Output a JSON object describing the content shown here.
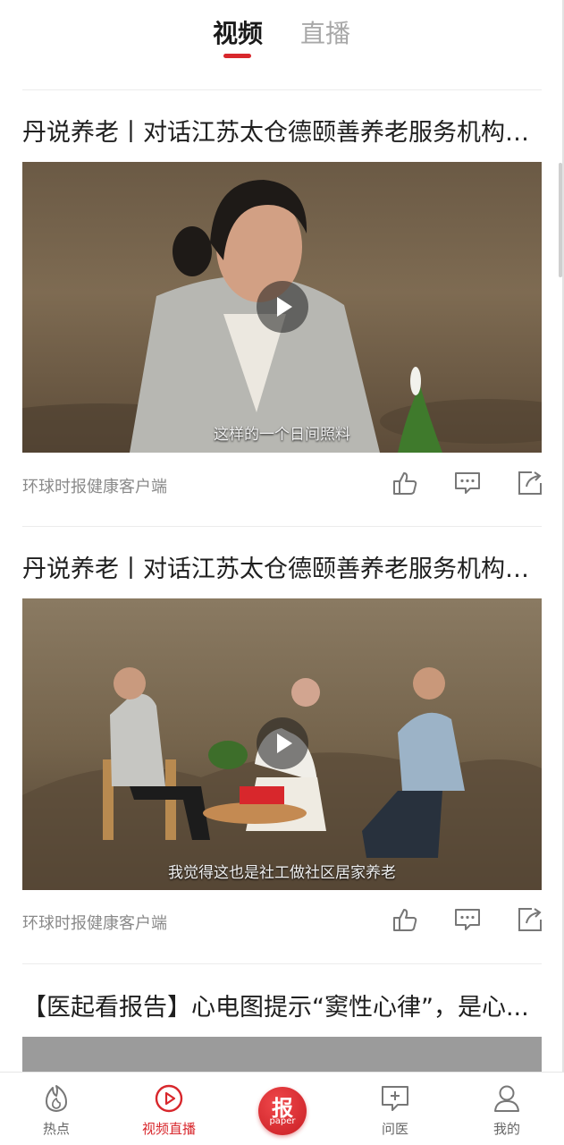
{
  "tabs": {
    "video": "视频",
    "live": "直播"
  },
  "feed": [
    {
      "title": "丹说养老丨对话江苏太仓德颐善养老服务机构负责人",
      "subtitle": "这样的一个日间照料",
      "source": "环球时报健康客户端"
    },
    {
      "title": "丹说养老丨对话江苏太仓德颐善养老服务机构负责人",
      "subtitle": "我觉得这也是社工做社区居家养老",
      "source": "环球时报健康客户端"
    },
    {
      "title": "【医起看报告】心电图提示“窦性心律”，是心..."
    }
  ],
  "bottom_nav": {
    "hot": "热点",
    "video_live": "视频直播",
    "paper_main": "报",
    "paper_sub": "paper",
    "ask_doctor": "问医",
    "mine": "我的"
  },
  "colors": {
    "accent": "#d8272c",
    "muted": "#8a8a8a"
  },
  "icons": [
    "fire-icon",
    "play-circle-icon",
    "paper-logo-icon",
    "ask-doctor-icon",
    "user-icon",
    "like-icon",
    "comment-icon",
    "share-icon",
    "play-icon"
  ]
}
